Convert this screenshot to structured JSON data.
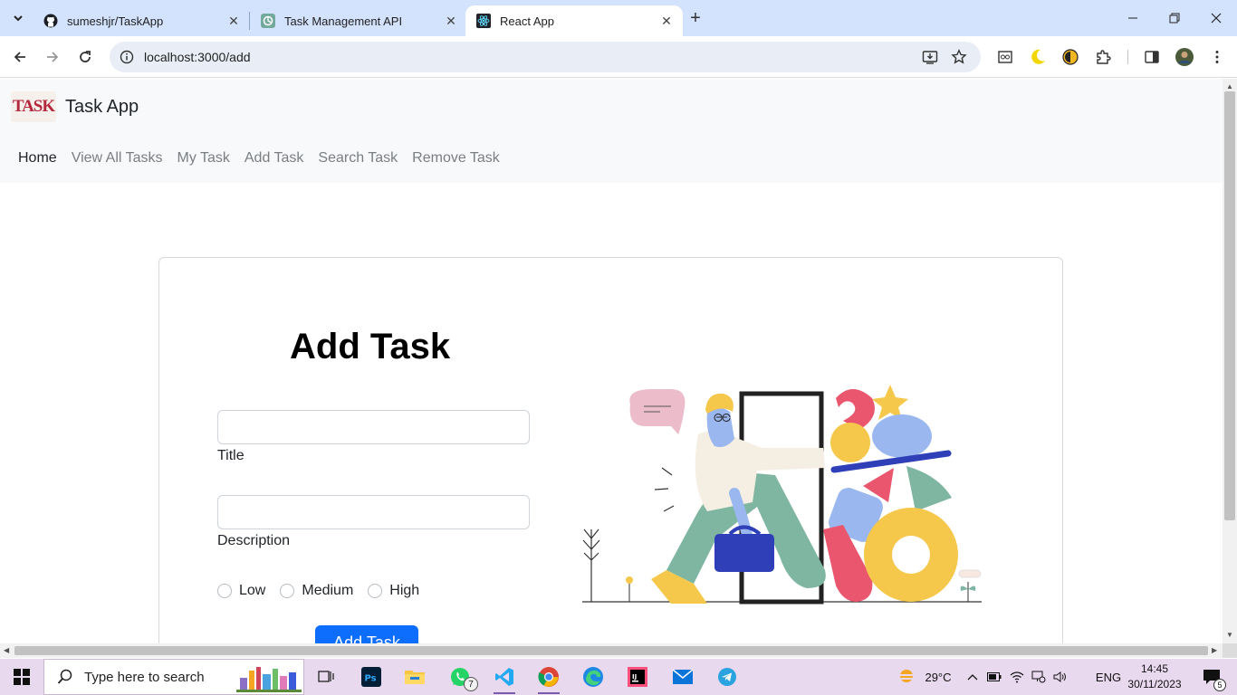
{
  "browser": {
    "tabs": [
      {
        "title": "sumeshjr/TaskApp",
        "icon": "github-icon"
      },
      {
        "title": "Task Management API",
        "icon": "openai-icon"
      },
      {
        "title": "React App",
        "icon": "react-icon",
        "active": true
      }
    ],
    "url": "localhost:3000/add"
  },
  "page": {
    "brand": "Task App",
    "logo_text": "TASK",
    "nav": [
      {
        "label": "Home",
        "active": true
      },
      {
        "label": "View All Tasks"
      },
      {
        "label": "My Task"
      },
      {
        "label": "Add Task"
      },
      {
        "label": "Search Task"
      },
      {
        "label": "Remove Task"
      }
    ],
    "form": {
      "heading": "Add Task",
      "title_label": "Title",
      "title_value": "",
      "description_label": "Description",
      "description_value": "",
      "priority_options": [
        "Low",
        "Medium",
        "High"
      ],
      "submit_label": "Add Task"
    },
    "illustration": "person-walking-through-door-with-shapes"
  },
  "taskbar": {
    "search_placeholder": "Type here to search",
    "weather": "29°C",
    "language": "ENG",
    "time": "14:45",
    "date": "30/11/2023",
    "whatsapp_badge": "7",
    "notification_count": "5"
  },
  "colors": {
    "accent": "#0d6efd",
    "tabstrip": "#d3e3fd",
    "navbar": "#f8f9fa",
    "taskbar": "#e9d9ef"
  }
}
